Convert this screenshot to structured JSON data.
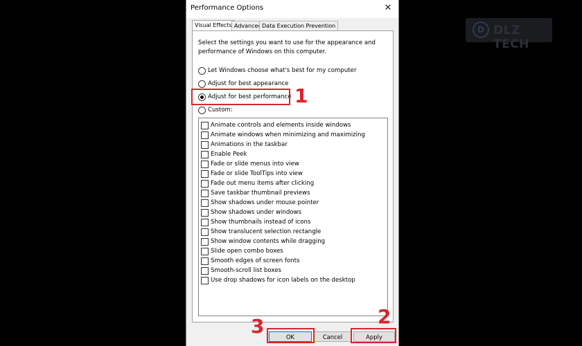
{
  "window": {
    "title": "Performance Options",
    "close_glyph": "✕"
  },
  "tabs": [
    {
      "label": "Visual Effects",
      "active": true
    },
    {
      "label": "Advanced",
      "active": false
    },
    {
      "label": "Data Execution Prevention",
      "active": false
    }
  ],
  "intro_text": "Select the settings you want to use for the appearance and performance of Windows on this computer.",
  "radios": [
    {
      "label": "Let Windows choose what's best for my computer",
      "checked": false
    },
    {
      "label": "Adjust for best appearance",
      "checked": false
    },
    {
      "label": "Adjust for best performance",
      "checked": true
    },
    {
      "label": "Custom:",
      "checked": false
    }
  ],
  "effects": [
    {
      "label": "Animate controls and elements inside windows",
      "checked": false
    },
    {
      "label": "Animate windows when minimizing and maximizing",
      "checked": false
    },
    {
      "label": "Animations in the taskbar",
      "checked": false
    },
    {
      "label": "Enable Peek",
      "checked": false
    },
    {
      "label": "Fade or slide menus into view",
      "checked": false
    },
    {
      "label": "Fade or slide ToolTips into view",
      "checked": false
    },
    {
      "label": "Fade out menu items after clicking",
      "checked": false
    },
    {
      "label": "Save taskbar thumbnail previews",
      "checked": false
    },
    {
      "label": "Show shadows under mouse pointer",
      "checked": false
    },
    {
      "label": "Show shadows under windows",
      "checked": false
    },
    {
      "label": "Show thumbnails instead of icons",
      "checked": false
    },
    {
      "label": "Show translucent selection rectangle",
      "checked": false
    },
    {
      "label": "Show window contents while dragging",
      "checked": false
    },
    {
      "label": "Slide open combo boxes",
      "checked": false
    },
    {
      "label": "Smooth edges of screen fonts",
      "checked": false
    },
    {
      "label": "Smooth-scroll list boxes",
      "checked": false
    },
    {
      "label": "Use drop shadows for icon labels on the desktop",
      "checked": false
    }
  ],
  "buttons": {
    "ok": "OK",
    "cancel": "Cancel",
    "apply": "Apply"
  },
  "annotations": {
    "step1": "1",
    "step2": "2",
    "step3": "3"
  },
  "watermark": {
    "mark": "D",
    "text": "DLZ TECH"
  },
  "colors": {
    "annotation_red": "#d8262c",
    "default_button_border": "#0078d7"
  }
}
